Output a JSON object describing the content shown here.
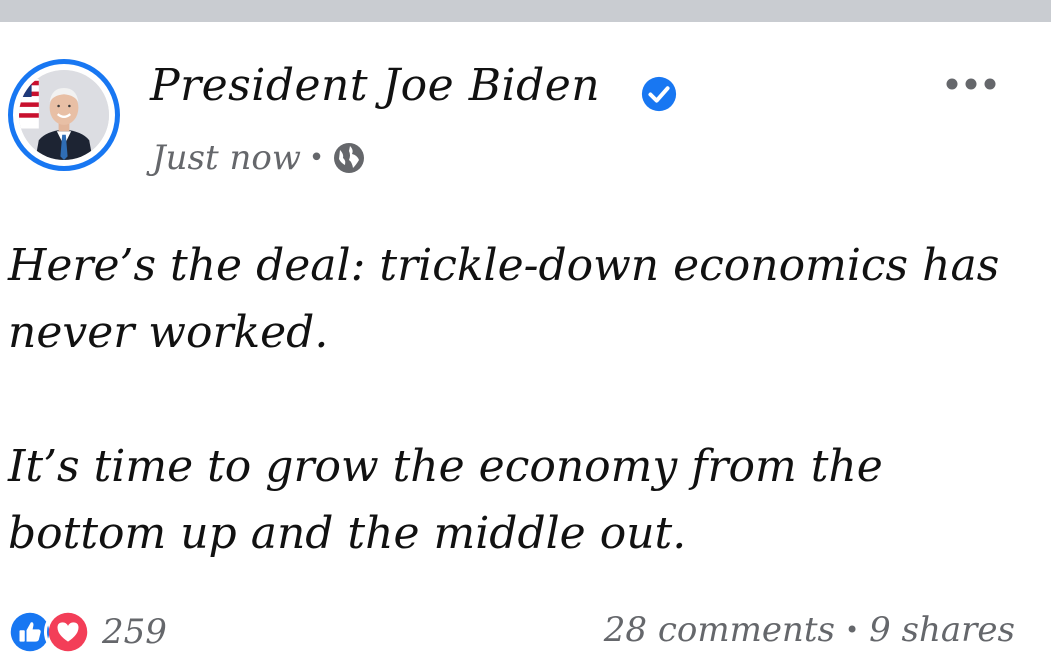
{
  "post": {
    "author": "President Joe Biden",
    "verified": true,
    "timestamp": "Just now",
    "meta_separator": "•",
    "audience_icon": "globe-icon",
    "menu_icon": "more-options-icon",
    "body": {
      "paragraph_1": "Here’s the deal: trickle-down economics has never worked.",
      "paragraph_2": "It’s time to grow the economy from the bottom up and the middle out."
    },
    "footer": {
      "reaction_icons": [
        "like-icon",
        "love-icon"
      ],
      "reaction_count": "259",
      "comments": "28 comments",
      "separator": "•",
      "shares": "9 shares"
    }
  },
  "colors": {
    "accent_blue": "#1877f2",
    "love_red": "#f33e58",
    "secondary_text": "#65676b",
    "top_bar": "#c9ccd1"
  }
}
